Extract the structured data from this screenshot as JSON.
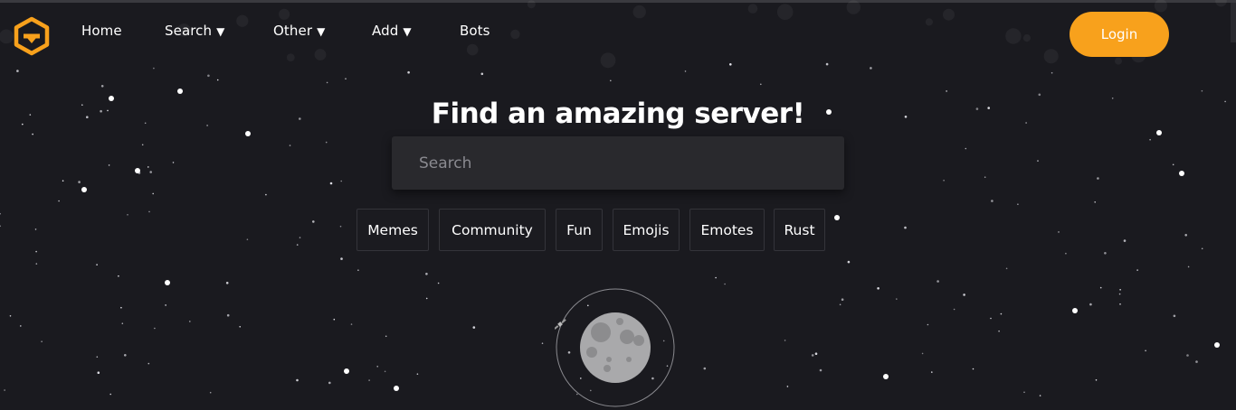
{
  "nav": {
    "links": [
      {
        "label": "Home"
      },
      {
        "label": "Search",
        "dropdown": true
      },
      {
        "label": "Other",
        "dropdown": true
      },
      {
        "label": "Add",
        "dropdown": true
      },
      {
        "label": "Bots"
      }
    ],
    "dropdown_arrow": "▼",
    "login_label": "Login",
    "logo_icon": "hexagon-logo-icon"
  },
  "hero": {
    "title": "Find an amazing server!",
    "search_placeholder": "Search",
    "tags": [
      "Memes",
      "Community",
      "Fun",
      "Emojis",
      "Emotes",
      "Rust"
    ]
  },
  "colors": {
    "background": "#1a1a1f",
    "accent": "#f8a11c",
    "search_bg": "#29292d",
    "tag_border": "#34343a"
  }
}
